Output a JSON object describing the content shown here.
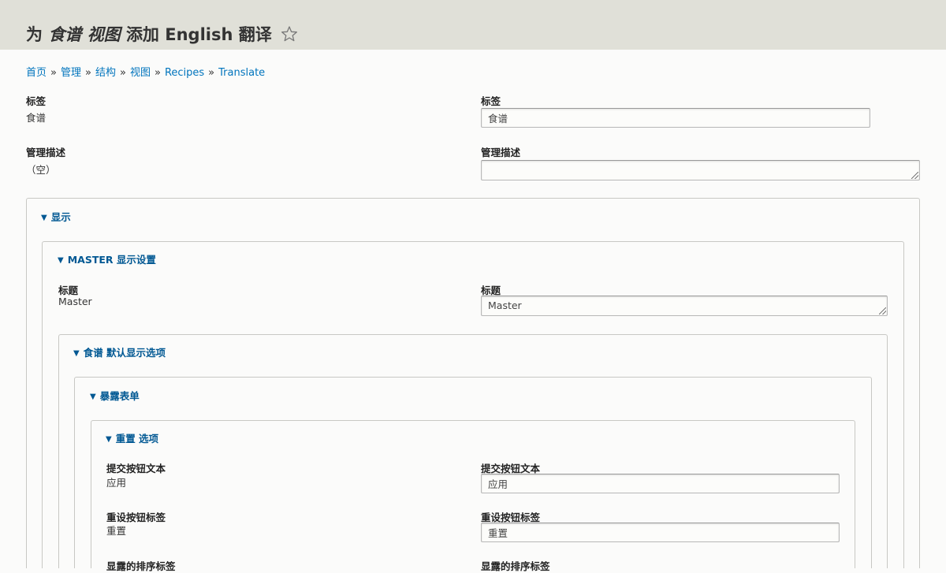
{
  "header": {
    "title_prefix": "为",
    "title_item1": "食谱",
    "title_item2": "视图",
    "title_suffix": "添加 English 翻译",
    "star_icon": "star-outline-icon"
  },
  "breadcrumb": {
    "items": [
      "首页",
      "管理",
      "结构",
      "视图",
      "Recipes",
      "Translate"
    ],
    "separator": "»"
  },
  "source": {
    "label_title": "标签",
    "label_value": "食谱",
    "admin_desc_title": "管理描述",
    "admin_desc_value": "（空）"
  },
  "translation": {
    "label_title": "标签",
    "label_value": "食谱",
    "admin_desc_title": "管理描述",
    "admin_desc_value": ""
  },
  "sections": {
    "display": "显示",
    "master_settings": "MASTER 显示设置",
    "default_display": "食谱 默认显示选项",
    "exposed_form": "暴露表单",
    "reset_options": "重置 选项"
  },
  "master": {
    "title_label": "标题",
    "source_value": "Master",
    "translated_label": "标题",
    "translated_value": "Master"
  },
  "reset_fields": {
    "submit_label": "提交按钮文本",
    "submit_source": "应用",
    "submit_translated_label": "提交按钮文本",
    "submit_value": "应用",
    "reset_label": "重设按钮标签",
    "reset_source": "重置",
    "reset_translated_label": "重设按钮标签",
    "reset_value": "重置",
    "sort_label": "显露的排序标签",
    "sort_translated_label": "显露的排序标签"
  },
  "colors": {
    "header_bg": "#e0e0d8",
    "link": "#0074bd",
    "summary_link": "#005893"
  }
}
